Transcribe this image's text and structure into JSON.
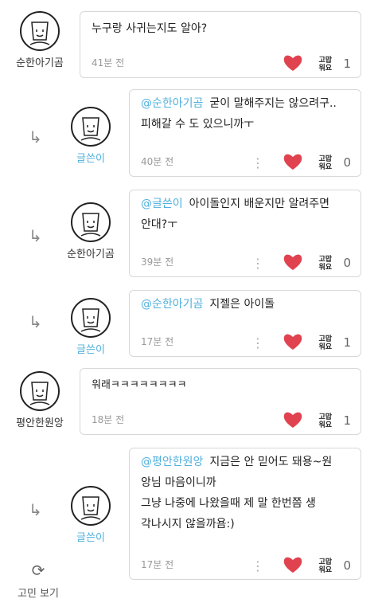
{
  "comments": [
    {
      "author": "순한아기곰",
      "mention": "",
      "text": "누구랑 사귀는지도 알아?",
      "time": "41분 전",
      "thanks": "고맙\n워요",
      "count": "1",
      "reply": false
    },
    {
      "author": "글쓴이",
      "mention": "@순한아기곰",
      "text": "굳이 말해주지는 않으려구..\n피해갈 수 도 있으니까ㅜ",
      "time": "40분 전",
      "thanks": "고맙\n워요",
      "count": "0",
      "reply": true
    },
    {
      "author": "순한아기곰",
      "mention": "@글쓴이",
      "text": "아이돌인지 배운지만 알려주면\n안대?ㅜ",
      "time": "39분 전",
      "thanks": "고맙\n워요",
      "count": "0",
      "reply": true
    },
    {
      "author": "글쓴이",
      "mention": "@순한아기곰",
      "text": "지젤은 아이돌",
      "time": "17분 전",
      "thanks": "고맙\n워요",
      "count": "1",
      "reply": true
    },
    {
      "author": "평안한원앙",
      "mention": "",
      "text": "워래ㅋㅋㅋㅋㅋㅋㅋㅋ",
      "time": "18분 전",
      "thanks": "고맙\n워요",
      "count": "1",
      "reply": false
    },
    {
      "author": "글쓴이",
      "mention": "@평안한원앙",
      "text": "지금은 안 믿어도 돼용~원\n앙님 마음이니까\n그냥 나중에 나왔을때 제 말 한번쯤 생\n각나시지 않을까욤:)",
      "time": "17분 전",
      "thanks": "고맙\n워요",
      "count": "0",
      "reply": true
    }
  ],
  "footer": {
    "refresh_label": "고민 보기",
    "refresh_icon": "refresh-icon"
  },
  "colors": {
    "heart": "#e0434f",
    "writer": "#4fb0dd",
    "mention": "#4fb0dd"
  }
}
